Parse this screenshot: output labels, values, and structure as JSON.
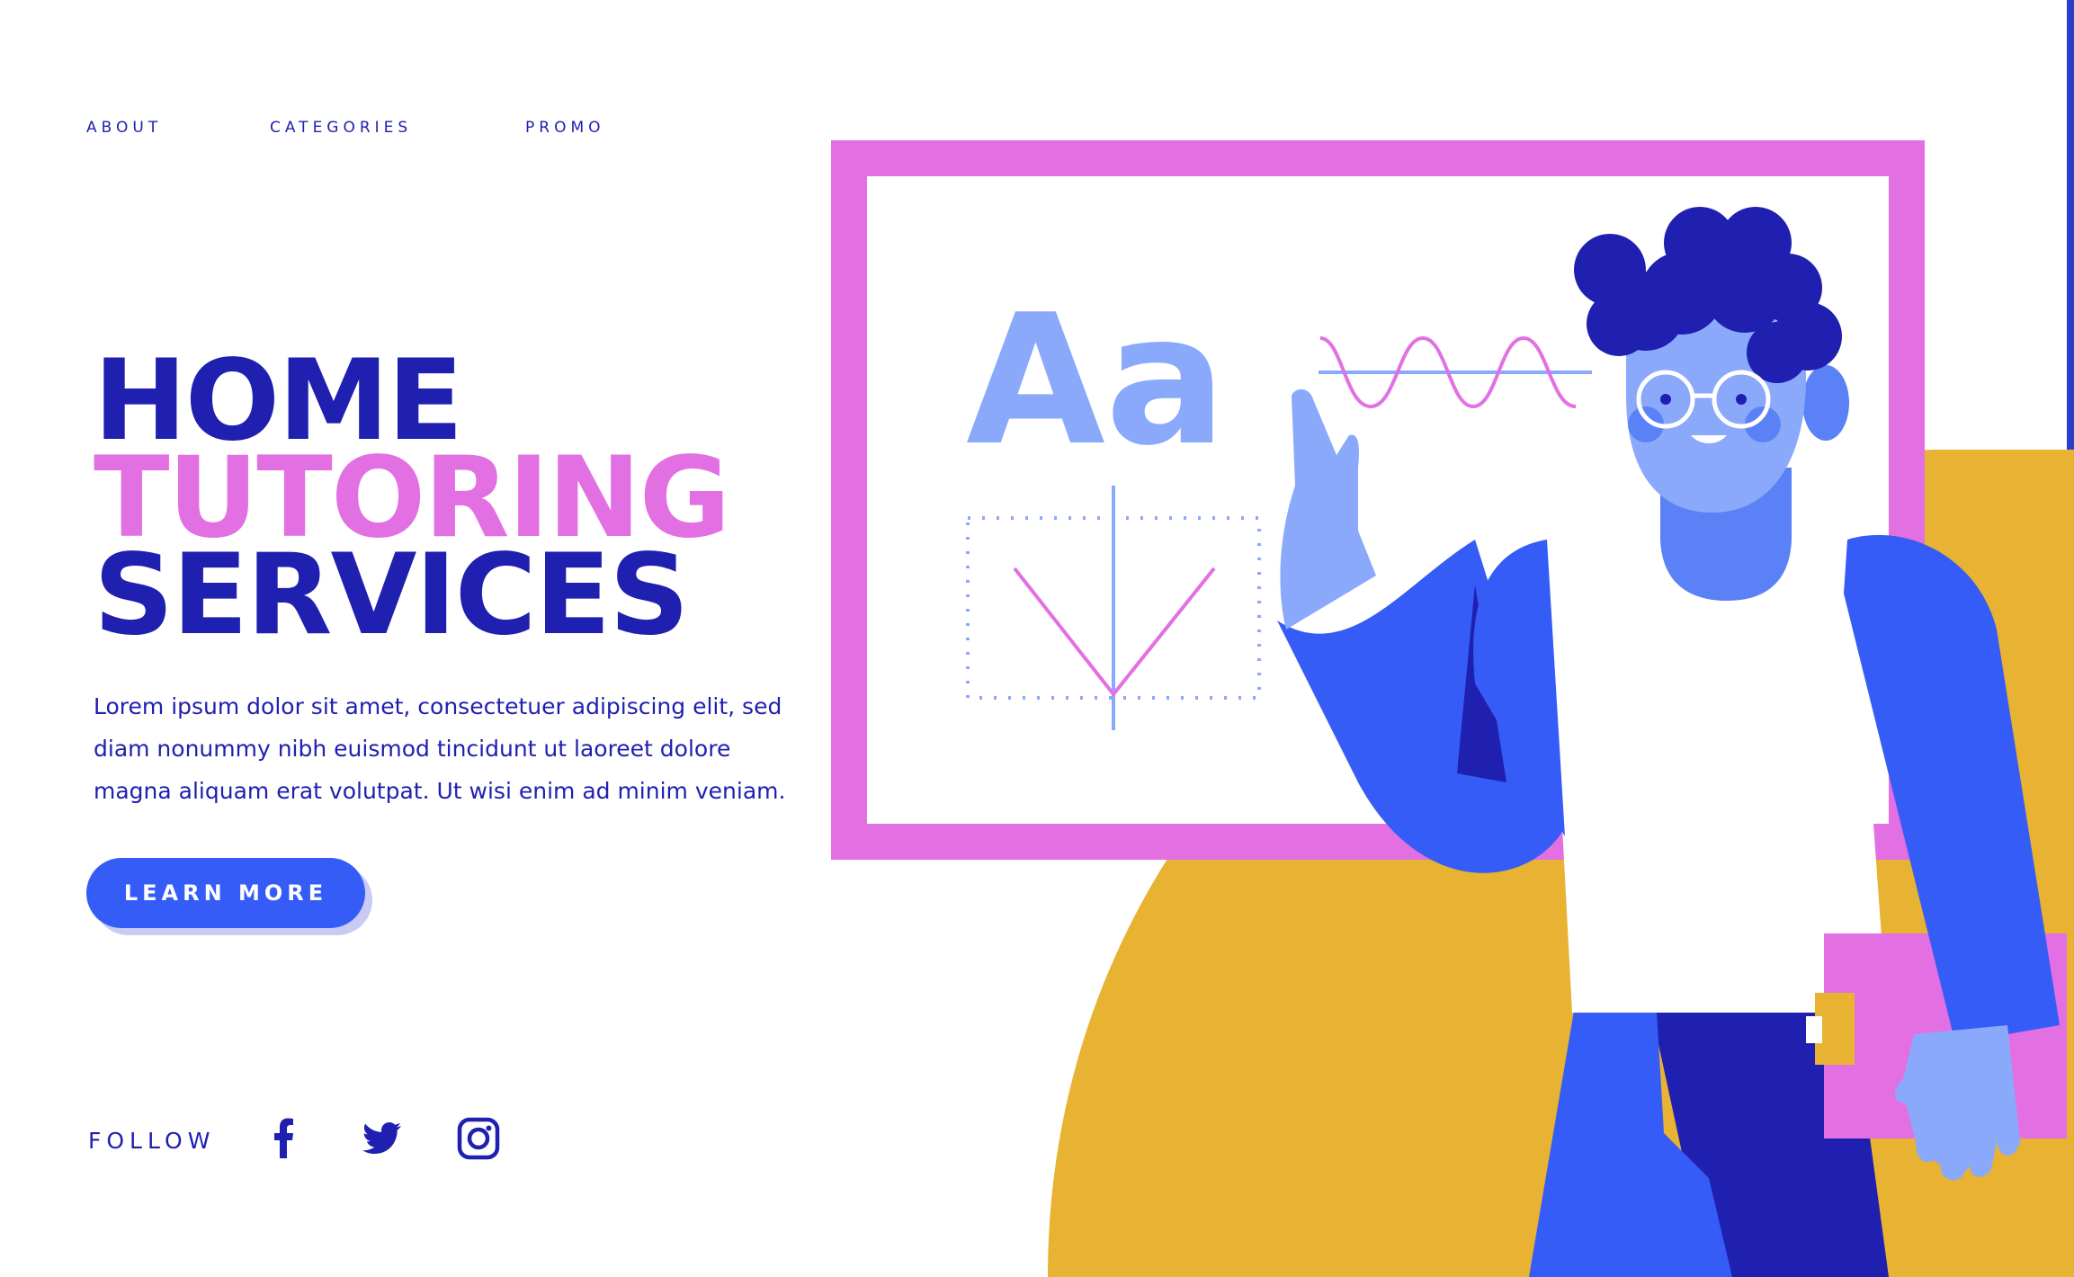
{
  "nav": {
    "about": "ABOUT",
    "categories": "CATEGORIES",
    "promo": "PROMO"
  },
  "hero": {
    "line1": "HOME",
    "line2": "TUTORING",
    "line3": "SERVICES",
    "body": "Lorem ipsum dolor sit amet, consectetuer adipiscing elit, sed diam nonummy nibh euismod tincidunt ut laoreet dolore magna aliquam erat volutpat. Ut wisi enim ad minim veniam.",
    "cta_label": "LEARN MORE"
  },
  "follow": {
    "label": "FOLLOW",
    "icons": [
      "facebook-icon",
      "twitter-icon",
      "instagram-icon"
    ]
  },
  "board": {
    "text": "Aa"
  },
  "colors": {
    "navy": "#1f1fb0",
    "pink": "#e270e3",
    "blue": "#355cf7",
    "light_blue": "#8aa9fb",
    "mustard": "#e8b232"
  }
}
